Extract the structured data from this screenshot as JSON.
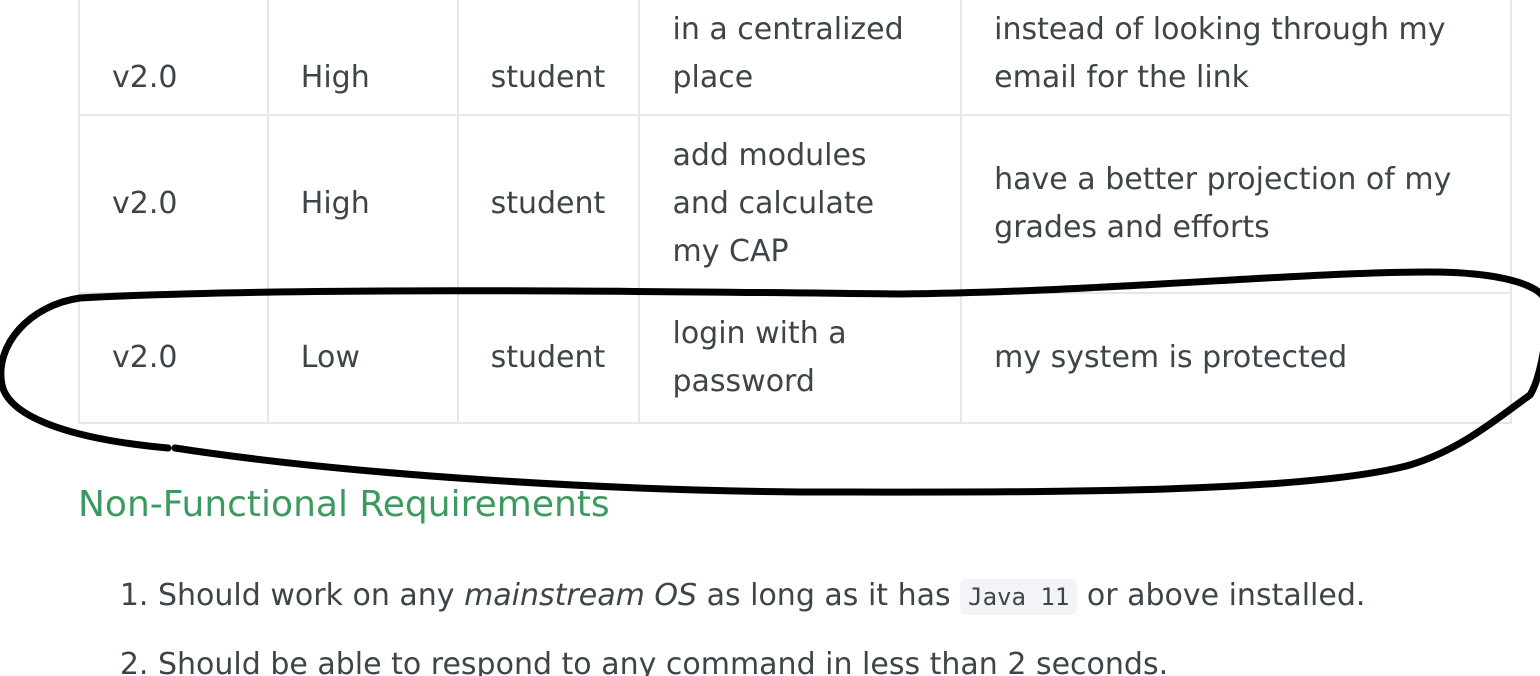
{
  "user_stories_table": {
    "rows": [
      {
        "version": "v2.0",
        "priority": "High",
        "user": "student",
        "want": "in a centralized place",
        "so_that": "instead of looking through my email for the link"
      },
      {
        "version": "v2.0",
        "priority": "High",
        "user": "student",
        "want": "add modules and calculate my CAP",
        "so_that": "have a better projection of my grades and efforts"
      },
      {
        "version": "v2.0",
        "priority": "Low",
        "user": "student",
        "want": "login with a password",
        "so_that": "my system is protected"
      }
    ]
  },
  "non_functional": {
    "heading": "Non-Functional Requirements",
    "items": [
      {
        "before": "Should work on any ",
        "emphasis": "mainstream OS",
        "middle": " as long as it has ",
        "code": "Java 11",
        "after": " or above installed."
      },
      {
        "text": "Should be able to respond to any command in less than 2 seconds."
      }
    ]
  },
  "annotation": {
    "stroke_color": "#000000",
    "shape": "hand-drawn-ellipse"
  }
}
